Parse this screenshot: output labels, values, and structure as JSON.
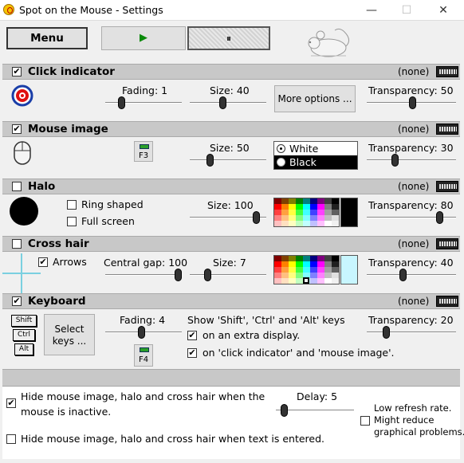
{
  "window": {
    "title": "Spot on the Mouse - Settings",
    "minimize_glyph": "—",
    "maximize_glyph": "☐",
    "close_glyph": "✕"
  },
  "toolbar": {
    "menu_label": "Menu",
    "play_glyph": "▶",
    "pause_glyph": "⏸"
  },
  "click_indicator": {
    "title": "Click indicator",
    "shortcut": "(none)",
    "fading_label": "Fading: 1",
    "size_label": "Size: 40",
    "more_options_label": "More options ...",
    "transparency_label": "Transparency: 50"
  },
  "mouse_image": {
    "title": "Mouse image",
    "shortcut": "(none)",
    "f3_label": "F3",
    "size_label": "Size: 50",
    "option_white": "White",
    "option_black": "Black",
    "transparency_label": "Transparency: 30"
  },
  "halo": {
    "title": "Halo",
    "shortcut": "(none)",
    "ring_shaped_label": "Ring shaped",
    "full_screen_label": "Full screen",
    "size_label": "Size: 100",
    "transparency_label": "Transparency: 80"
  },
  "cross_hair": {
    "title": "Cross hair",
    "shortcut": "(none)",
    "arrows_label": "Arrows",
    "central_gap_label": "Central gap: 100",
    "size_label": "Size: 7",
    "transparency_label": "Transparency: 40"
  },
  "keyboard": {
    "title": "Keyboard",
    "shortcut": "(none)",
    "key_shift": "Shift",
    "key_ctrl": "Ctrl",
    "key_alt": "Alt",
    "select_keys_line1": "Select",
    "select_keys_line2": "keys ...",
    "fading_label": "Fading: 4",
    "f4_label": "F4",
    "show_keys_label": "Show 'Shift', 'Ctrl' and 'Alt' keys",
    "extra_display_label": "on an extra display.",
    "on_indicator_label": "on 'click indicator' and 'mouse image'.",
    "transparency_label": "Transparency: 20"
  },
  "bottom": {
    "hide_inactive_line1": "Hide mouse image, halo and cross hair when the",
    "hide_inactive_line2": "mouse is inactive.",
    "delay_label": "Delay: 5",
    "low_refresh_line1": "Low refresh rate.",
    "low_refresh_line2": "Might reduce",
    "low_refresh_line3": "graphical problems.",
    "hide_text_label": "Hide mouse image, halo and cross hair when text is entered."
  }
}
